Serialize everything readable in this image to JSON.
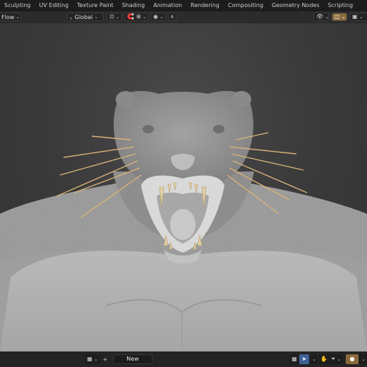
{
  "workspace_tabs": [
    "Sculpting",
    "UV Editing",
    "Texture Paint",
    "Shading",
    "Animation",
    "Rendering",
    "Compositing",
    "Geometry Nodes",
    "Scripting"
  ],
  "toolbar": {
    "left_dropdown": "Flow",
    "orientation": "Global",
    "snap_icon": "snap-icon",
    "proportional_icon": "proportional-edit-icon"
  },
  "bottombar": {
    "new_label": "New",
    "add_symbol": "+"
  },
  "colors": {
    "fur": "#bdbdbd",
    "whiskers": "#d9b277",
    "teeth": "#e0cfa6",
    "accent": "#3f6096"
  }
}
